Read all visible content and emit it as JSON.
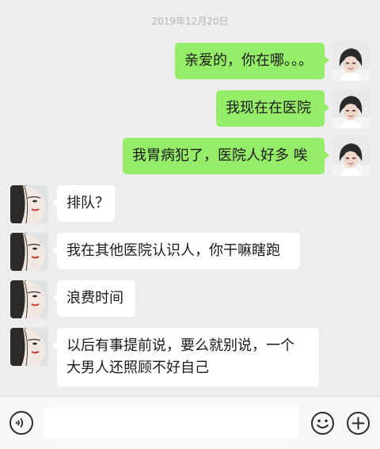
{
  "chat": {
    "timestamp": "2019年12月20日",
    "messages": [
      {
        "side": "sent",
        "text": "亲爱的，你在哪。。。",
        "avatar": "user-avatar-icon"
      },
      {
        "side": "sent",
        "text": "我现在在医院",
        "avatar": "user-avatar-icon"
      },
      {
        "side": "sent",
        "text": "我胃病犯了，医院人好多 唉",
        "avatar": "user-avatar-icon"
      },
      {
        "side": "received",
        "text": "排队？",
        "avatar": "contact-avatar-icon"
      },
      {
        "side": "received",
        "text": "我在其他医院认识人，你干嘛瞎跑",
        "avatar": "contact-avatar-icon"
      },
      {
        "side": "received",
        "text": "浪费时间",
        "avatar": "contact-avatar-icon"
      },
      {
        "side": "received",
        "lines": [
          "以后有事提前说，要么就别说，一个",
          "大男人还照顾不好自己"
        ],
        "avatar": "contact-avatar-icon"
      }
    ]
  },
  "input_bar": {
    "voice_icon": "voice-icon",
    "text_value": "",
    "emoji_icon": "emoji-icon",
    "plus_icon": "plus-icon"
  },
  "colors": {
    "background": "#ededed",
    "sent_bubble": "#95ec69",
    "received_bubble": "#ffffff",
    "timestamp_text": "#b5b5b5"
  }
}
